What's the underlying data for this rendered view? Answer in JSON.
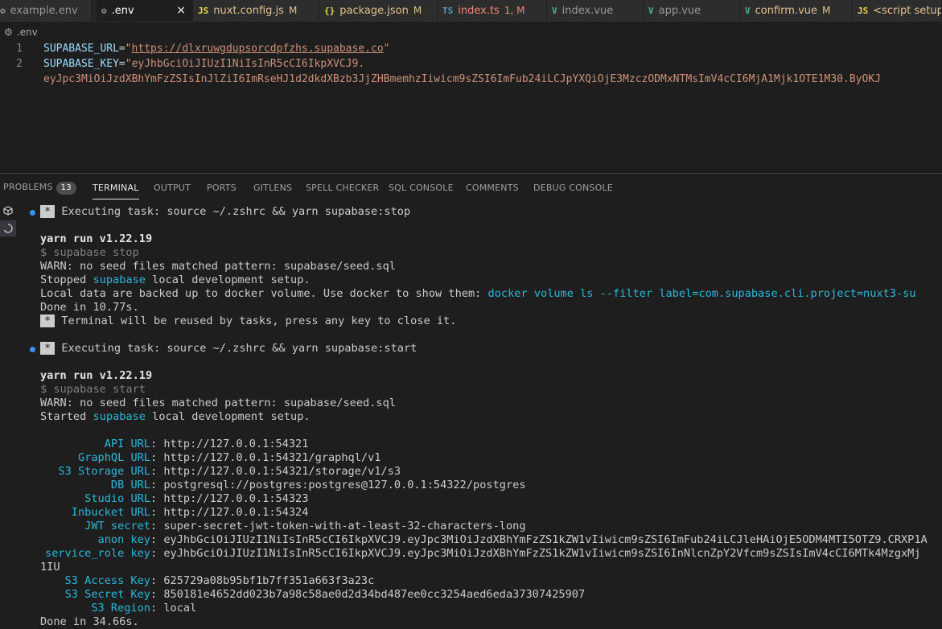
{
  "tabs": [
    {
      "icon": "⚙",
      "icon_name": "gear-icon",
      "label": "example.env",
      "modified": "",
      "color": "#969696"
    },
    {
      "icon": "⚙",
      "icon_name": "gear-icon",
      "label": ".env",
      "modified": "",
      "color": "#ffffff"
    },
    {
      "icon": "JS",
      "icon_name": "js-file-icon",
      "label": "nuxt.config.js",
      "modified": "M",
      "color": "#e2c08d"
    },
    {
      "icon": "{}",
      "icon_name": "json-file-icon",
      "label": "package.json",
      "modified": "M",
      "color": "#e2c08d"
    },
    {
      "icon": "TS",
      "icon_name": "ts-file-icon",
      "label": "index.ts",
      "modified": "1, M",
      "color": "#f48771"
    },
    {
      "icon": "V",
      "icon_name": "vue-file-icon",
      "label": "index.vue",
      "modified": "",
      "color": "#969696"
    },
    {
      "icon": "V",
      "icon_name": "vue-file-icon",
      "label": "app.vue",
      "modified": "",
      "color": "#969696"
    },
    {
      "icon": "V",
      "icon_name": "vue-file-icon",
      "label": "confirm.vue",
      "modified": "M",
      "color": "#e2c08d"
    },
    {
      "icon": "JS",
      "icon_name": "js-file-icon",
      "label": "<script setup",
      "modified": "",
      "color": "#e2c08d"
    }
  ],
  "close_glyph": "×",
  "breadcrumb": {
    "icon": "⚙",
    "file": ".env"
  },
  "editor": {
    "lines": [
      {
        "num": "1",
        "key": "SUPABASE_URL",
        "eq": "=",
        "q1": "\"",
        "value": "https://dlxruwgdupsorcdpfzhs.supabase.co",
        "q2": "\""
      },
      {
        "num": "2",
        "key": "SUPABASE_KEY",
        "eq": "=",
        "value": "\"eyJhbGciOiJIUzI1NiIsInR5cCI6IkpXVCJ9."
      }
    ],
    "wrap": "eyJpc3MiOiJzdXBhYmFzZSIsInJlZiI6ImRseHJ1d2dkdXBzb3JjZHBmemhzIiwicm9sZSI6ImFub24iLCJpYXQiOjE3MzczODMxNTMsImV4cCI6MjA1Mjk1OTE1M30.ByOKJ"
  },
  "panel": {
    "problems_label": "PROBLEMS",
    "problems_count": "13",
    "tabs": [
      "TERMINAL",
      "OUTPUT",
      "PORTS",
      "GITLENS",
      "SPELL CHECKER",
      "SQL CONSOLE",
      "COMMENTS",
      "DEBUG CONSOLE"
    ]
  },
  "terminal": {
    "star": "*",
    "task1": "Executing task: source ~/.zshrc && yarn supabase:stop",
    "yarn1": "yarn run v1.22.19",
    "cmd1": "$ supabase stop",
    "warn1": "WARN: no seed files matched pattern: supabase/seed.sql",
    "stopped_a": "Stopped ",
    "stopped_b": "supabase",
    "stopped_c": " local development setup.",
    "backup_a": "Local data are backed up to docker volume. Use docker to show them: ",
    "backup_b": "docker volume ls --filter label=com.supabase.cli.project=nuxt3-su",
    "done1": "Done in 10.77s.",
    "reuse": "Terminal will be reused by tasks, press any key to close it.",
    "task2": "Executing task: source ~/.zshrc && yarn supabase:start",
    "yarn2": "yarn run v1.22.19",
    "cmd2": "$ supabase start",
    "warn2": "WARN: no seed files matched pattern: supabase/seed.sql",
    "started_a": "Started ",
    "started_b": "supabase",
    "started_c": " local development setup.",
    "services": [
      {
        "name": "API URL",
        "value": "http://127.0.0.1:54321"
      },
      {
        "name": "GraphQL URL",
        "value": "http://127.0.0.1:54321/graphql/v1"
      },
      {
        "name": "S3 Storage URL",
        "value": "http://127.0.0.1:54321/storage/v1/s3"
      },
      {
        "name": "DB URL",
        "value": "postgresql://postgres:postgres@127.0.0.1:54322/postgres"
      },
      {
        "name": "Studio URL",
        "value": "http://127.0.0.1:54323"
      },
      {
        "name": "Inbucket URL",
        "value": "http://127.0.0.1:54324"
      },
      {
        "name": "JWT secret",
        "value": "super-secret-jwt-token-with-at-least-32-characters-long"
      },
      {
        "name": "anon key",
        "value": "eyJhbGciOiJIUzI1NiIsInR5cCI6IkpXVCJ9.eyJpc3MiOiJzdXBhYmFzZS1kZW1vIiwicm9sZSI6ImFub24iLCJleHAiOjE5ODM4MTI5OTZ9.CRXP1A"
      },
      {
        "name": "service_role key",
        "value": "eyJhbGciOiJIUzI1NiIsInR5cCI6IkpXVCJ9.eyJpc3MiOiJzdXBhYmFzZS1kZW1vIiwicm9sZSI6InNlcnZpY2Vfcm9sZSIsImV4cCI6MTk4MzgxMj"
      }
    ],
    "wrap_1iu": "1IU",
    "s3": [
      {
        "name": "S3 Access Key",
        "value": "625729a08b95bf1b7ff351a663f3a23c"
      },
      {
        "name": "S3 Secret Key",
        "value": "850181e4652dd023b7a98c58ae0d2d34bd487ee0cc3254aed6eda37307425907"
      },
      {
        "name": "S3 Region",
        "value": "local"
      }
    ],
    "done2": "Done in 34.66s."
  },
  "colors": {
    "accent": "#3794ff",
    "cyan": "#29b8db",
    "string": "#ce9178",
    "key": "#9cdcfe"
  }
}
